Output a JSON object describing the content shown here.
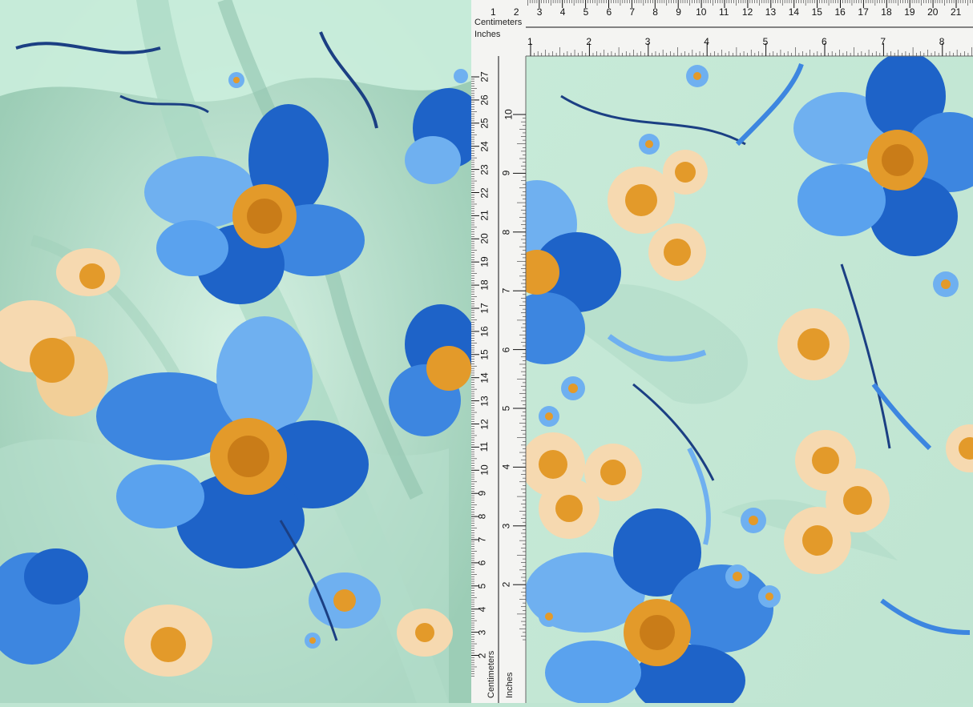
{
  "photo": {
    "subject": "drape-and-flat-fabric",
    "colors": {
      "background": "#bfe5d2",
      "mint": "#c9ead8",
      "mint_shadow": "#9fd1bd",
      "blue_dark": "#1e63c8",
      "blue_light": "#6fb0f0",
      "peach": "#f6d9b0",
      "orange": "#e39a2a",
      "navy": "#1b3f83",
      "ruler_bg": "#f4f4f2",
      "ruler_ink": "#111111"
    }
  },
  "ruler_top": {
    "unit_cm_label": "Centimeters",
    "unit_in_label": "Inches",
    "cm_numbers": [
      "1",
      "2",
      "3",
      "4",
      "5",
      "6",
      "7",
      "8",
      "9",
      "10",
      "11",
      "12",
      "13",
      "14",
      "15",
      "16",
      "17",
      "18",
      "19",
      "20",
      "21"
    ],
    "in_numbers": [
      "1",
      "2",
      "3",
      "4",
      "5",
      "6",
      "7",
      "8"
    ]
  },
  "ruler_left": {
    "unit_cm_label": "Centimeters",
    "unit_in_label": "Inches",
    "cm_numbers": [
      "27",
      "26",
      "25",
      "24",
      "23",
      "22",
      "21",
      "20",
      "19",
      "18",
      "17",
      "16",
      "15",
      "14",
      "13",
      "12",
      "11",
      "10",
      "9",
      "8",
      "7",
      "6",
      "5",
      "4",
      "3",
      "2"
    ],
    "in_numbers": [
      "10",
      "9",
      "8",
      "7",
      "6",
      "5",
      "4",
      "3",
      "2"
    ]
  }
}
